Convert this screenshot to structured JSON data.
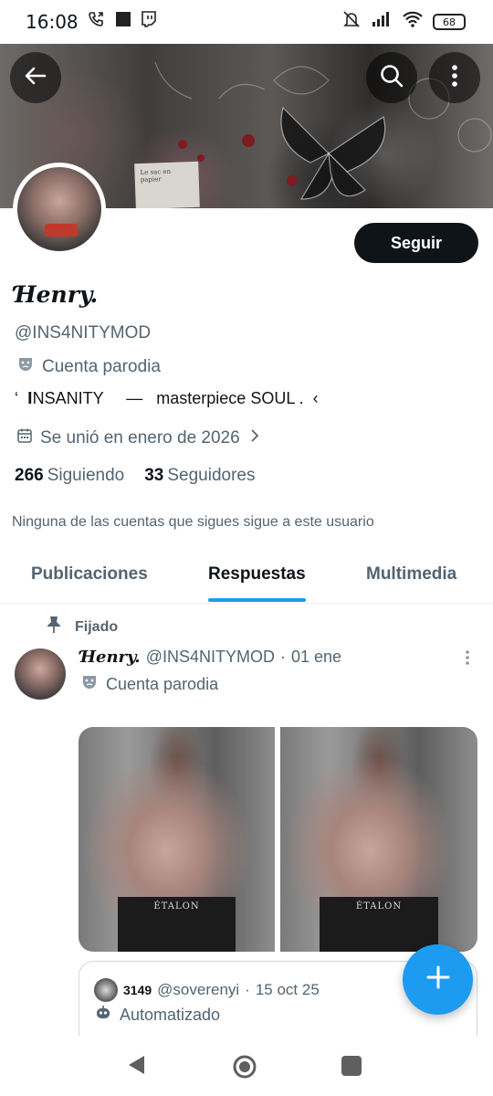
{
  "status_bar": {
    "time": "16:08",
    "battery": "68",
    "left_icons": [
      "call-forward-icon",
      "square-notification-icon",
      "twitch-icon"
    ],
    "right_icons": [
      "mute-icon",
      "signal-icon",
      "wifi-icon",
      "battery-icon"
    ]
  },
  "banner": {
    "paper_text": "Le sac en papier"
  },
  "header_buttons": {
    "back": "back-arrow-icon",
    "search": "search-icon",
    "more": "more-vertical-icon"
  },
  "profile": {
    "display_name": "Ɦenry.",
    "handle": "@INS4NITYMOD",
    "label": "Cuenta parodia",
    "bio": "‘  𝐈NSANITY     —   masterpiece SOUL .  ‹",
    "joined": "Se unió en enero de 2026",
    "following_count": "266",
    "following_label": "Siguiendo",
    "followers_count": "33",
    "followers_label": "Seguidores",
    "mutuals_note": "Ninguna de las cuentas que sigues sigue a este usuario",
    "follow_button": "Seguir"
  },
  "tabs": [
    {
      "label": "Publicaciones",
      "active": false
    },
    {
      "label": "Respuestas",
      "active": true
    },
    {
      "label": "Multimedia",
      "active": false
    }
  ],
  "pinned_post": {
    "pinned_label": "Fijado",
    "author_name": "Ɦenry.",
    "author_handle": "@INS4NITYMOD",
    "separator": "·",
    "date": "01 ene",
    "author_label": "Cuenta parodia",
    "media_text": [
      "ÉTALON",
      "ÉTALON"
    ],
    "quote": {
      "name": "3149",
      "handle": "@soverenyi",
      "separator": "·",
      "date": "15 oct 25",
      "label": "Automatizado"
    }
  },
  "colors": {
    "accent": "#1d9bf0",
    "text_primary": "#0f1419",
    "text_secondary": "#536471"
  }
}
